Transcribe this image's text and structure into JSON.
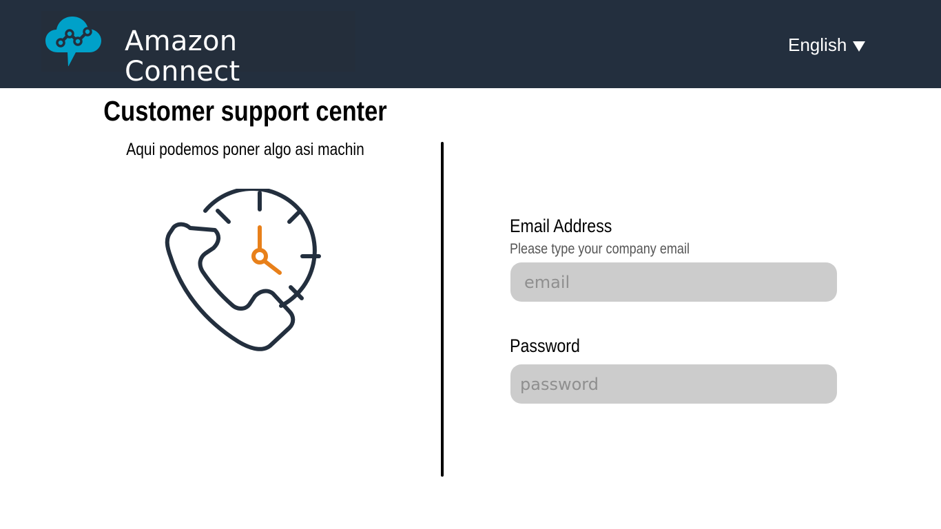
{
  "header": {
    "brand_name": "Amazon Connect",
    "language": "English",
    "background_color": "#232f3e",
    "logo_color": "#00a1c9",
    "logo_icon": "cloud-chat-network-icon",
    "caret_icon": "caret-down-icon"
  },
  "hero": {
    "title": "Customer support center",
    "subtitle": "Aqui podemos poner algo asi machin",
    "illustration": "phone-clock-icon",
    "illustration_color": "#232f3e",
    "accent_color": "#e8801a"
  },
  "form": {
    "email": {
      "label": "Email Address",
      "help": "Please type your company email",
      "placeholder": "email",
      "value": ""
    },
    "password": {
      "label": "Password",
      "placeholder": "password",
      "value": ""
    },
    "input_background": "#cccccc"
  }
}
